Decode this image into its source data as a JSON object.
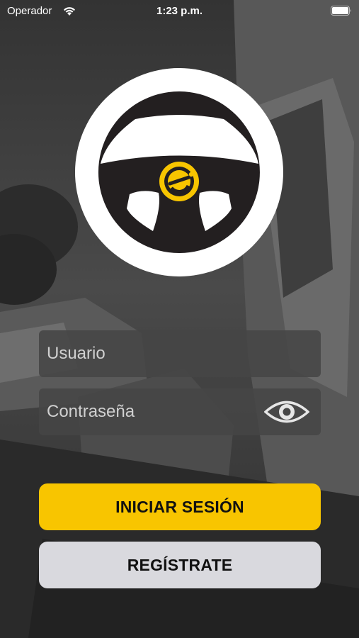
{
  "status_bar": {
    "carrier": "Operador",
    "time": "1:23 p.m."
  },
  "logo": {
    "icon": "steering-wheel-logo",
    "ring_color": "#ffffff",
    "wheel_color": "#231f20",
    "accent_color": "#f8c500"
  },
  "form": {
    "username_placeholder": "Usuario",
    "password_placeholder": "Contraseña",
    "password_toggle_icon": "eye-icon"
  },
  "buttons": {
    "login_label": "INICIAR SESIÓN",
    "register_label": "REGÍSTRATE"
  },
  "colors": {
    "primary": "#f8c500",
    "secondary": "#d9d9de",
    "field_background": "#464646"
  }
}
